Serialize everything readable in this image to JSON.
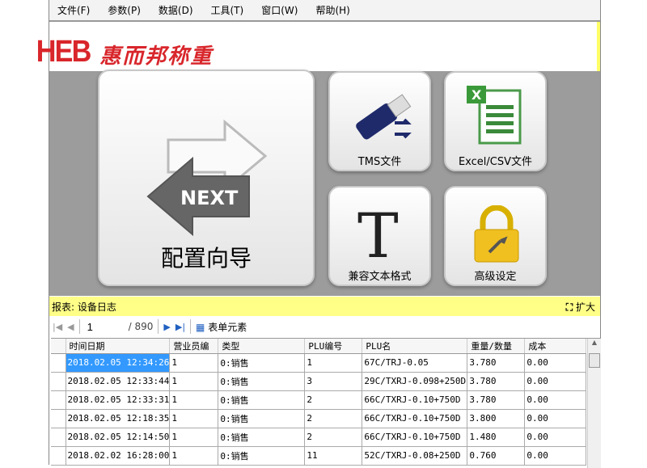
{
  "menu": [
    "文件(F)",
    "参数(P)",
    "数据(D)",
    "工具(T)",
    "窗口(W)",
    "帮助(H)"
  ],
  "logo": {
    "mark": "HEB",
    "name": "惠而邦称重"
  },
  "tiles": {
    "wizard": "配置向导",
    "wizard_arrow_text": "NEXT",
    "tms": "TMS文件",
    "excel": "Excel/CSV文件",
    "compat": "兼容文本格式",
    "advanced": "高级设定"
  },
  "report": {
    "title": "报表: 设备日志",
    "expand": "扩大"
  },
  "pager": {
    "current": "1",
    "total": "/ 890",
    "form_elements": "表单元素"
  },
  "table": {
    "headers": [
      "时间日期",
      "营业员编",
      "类型",
      "PLU编号",
      "PLU名",
      "重量/数量",
      "成本"
    ],
    "rows": [
      [
        "2018.02.05 12:34:26",
        "1",
        "0:销售",
        "1",
        "67C/TRJ-0.05",
        "3.780",
        "0.00"
      ],
      [
        "2018.02.05 12:33:44",
        "1",
        "0:销售",
        "3",
        "29C/TXRJ-0.098+250D",
        "3.780",
        "0.00"
      ],
      [
        "2018.02.05 12:33:31",
        "1",
        "0:销售",
        "2",
        "66C/TXRJ-0.10+750D",
        "3.780",
        "0.00"
      ],
      [
        "2018.02.05 12:18:35",
        "1",
        "0:销售",
        "2",
        "66C/TXRJ-0.10+750D",
        "3.800",
        "0.00"
      ],
      [
        "2018.02.05 12:14:50",
        "1",
        "0:销售",
        "2",
        "66C/TXRJ-0.10+750D",
        "1.480",
        "0.00"
      ],
      [
        "2018.02.02 16:28:00",
        "1",
        "0:销售",
        "11",
        "52C/TXRJ-0.08+250D",
        "0.760",
        "0.00"
      ]
    ]
  },
  "colors": {
    "accent": "#3399ff",
    "report_bar": "#ffff88",
    "logo": "#d8262b",
    "background": "#9c9c9c"
  }
}
